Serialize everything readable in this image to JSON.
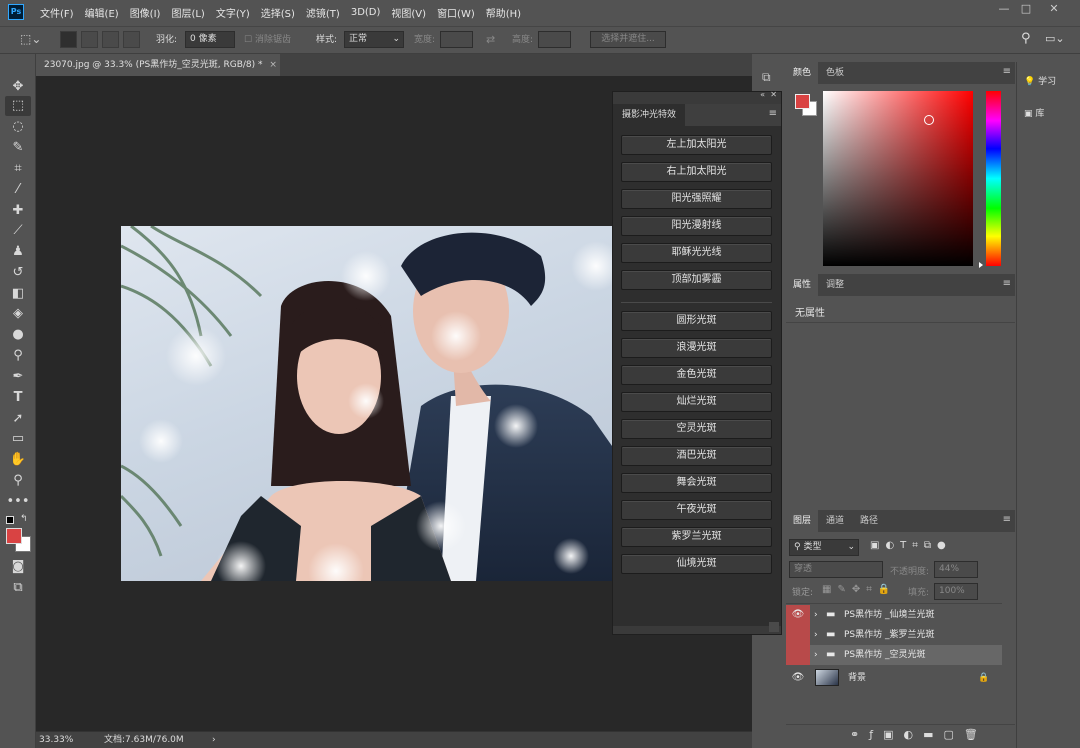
{
  "app": {
    "logo": "Ps"
  },
  "menu": [
    "文件(F)",
    "编辑(E)",
    "图像(I)",
    "图层(L)",
    "文字(Y)",
    "选择(S)",
    "滤镜(T)",
    "3D(D)",
    "视图(V)",
    "窗口(W)",
    "帮助(H)"
  ],
  "window": {
    "minimize": "—",
    "maximize": "□",
    "close": "✕"
  },
  "options": {
    "feather_label": "羽化:",
    "feather_value": "0 像素",
    "antialias": "消除锯齿",
    "style_label": "样式:",
    "style_value": "正常",
    "width_label": "宽度:",
    "height_label": "高度:",
    "select_mask": "选择并遮住..."
  },
  "document": {
    "tab_title": "23070.jpg @ 33.3% (PS黑作坊_空灵光斑, RGB/8) *",
    "tab_close": "×",
    "zoom": "33.33%",
    "doc_size": "文档:7.63M/76.0M",
    "arrow": "›"
  },
  "plugin": {
    "tab": "摄影冲光特效",
    "group1": [
      "左上加太阳光",
      "右上加太阳光",
      "阳光强照耀",
      "阳光漫射线",
      "耶稣光光线",
      "顶部加雾霾"
    ],
    "group2": [
      "圆形光斑",
      "浪漫光斑",
      "金色光斑",
      "灿烂光斑",
      "空灵光斑",
      "酒巴光斑",
      "舞会光斑",
      "午夜光斑",
      "紫罗兰光斑",
      "仙境光斑"
    ]
  },
  "panels": {
    "color_tabs": [
      "颜色",
      "色板"
    ],
    "props_tabs": [
      "属性",
      "调整"
    ],
    "props_empty": "无属性",
    "layers_tabs": [
      "图层",
      "通道",
      "路径"
    ],
    "layers_filter": "类型",
    "blend_mode": "穿透",
    "opacity_label": "不透明度:",
    "opacity_value": "44%",
    "lock_label": "锁定:",
    "fill_label": "填充:",
    "fill_value": "100%",
    "layers": [
      {
        "name": "PS黑作坊 _仙境兰光斑"
      },
      {
        "name": "PS黑作坊 _紫罗兰光斑"
      },
      {
        "name": "PS黑作坊 _空灵光斑"
      },
      {
        "name": "背景"
      }
    ]
  },
  "right_dock": {
    "learn": "学习",
    "library": "库"
  },
  "colors": {
    "foreground": "#d94343",
    "background": "#ffffff",
    "visible_cell": "#b84a4a"
  }
}
